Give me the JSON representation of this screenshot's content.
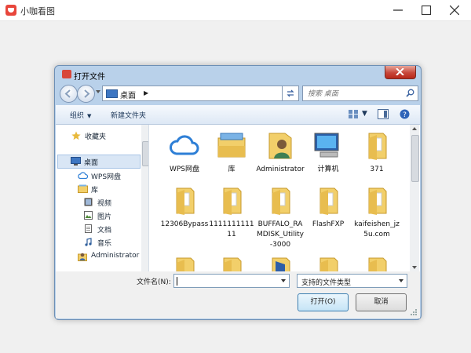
{
  "app": {
    "title": "小咖看图"
  },
  "dialog": {
    "title": "打开文件",
    "address": {
      "location": "桌面"
    },
    "search": {
      "placeholder": "搜索 桌面"
    },
    "toolbar": {
      "organize": "组织",
      "new_folder": "新建文件夹"
    },
    "sidebar": {
      "items": [
        {
          "label": "收藏夹",
          "icon": "star-icon"
        },
        {
          "label": "桌面",
          "icon": "desktop-icon",
          "selected": true
        },
        {
          "label": "WPS网盘",
          "icon": "cloud-icon"
        },
        {
          "label": "库",
          "icon": "library-icon"
        },
        {
          "label": "视频",
          "icon": "video-icon"
        },
        {
          "label": "图片",
          "icon": "picture-icon"
        },
        {
          "label": "文档",
          "icon": "document-icon"
        },
        {
          "label": "音乐",
          "icon": "music-icon"
        },
        {
          "label": "Administrator",
          "icon": "user-icon"
        }
      ]
    },
    "files": [
      {
        "name": "WPS网盘",
        "icon": "cloud-icon"
      },
      {
        "name": "库",
        "icon": "library-icon"
      },
      {
        "name": "Administrator",
        "icon": "user-folder-icon"
      },
      {
        "name": "计算机",
        "icon": "computer-icon"
      },
      {
        "name": "371",
        "icon": "folder-icon"
      },
      {
        "name": "12306Bypass",
        "icon": "folder-icon"
      },
      {
        "name": "111111111111",
        "icon": "folder-icon"
      },
      {
        "name": "BUFFALO_RAMDISK_Utility-3000",
        "icon": "folder-icon"
      },
      {
        "name": "FlashFXP",
        "icon": "folder-icon"
      },
      {
        "name": "kaifeishen_jz5u.com",
        "icon": "folder-icon"
      },
      {
        "name": "",
        "icon": "folder-icon"
      },
      {
        "name": "",
        "icon": "folder-icon"
      },
      {
        "name": "",
        "icon": "folder-icon"
      },
      {
        "name": "",
        "icon": "folder-icon"
      },
      {
        "name": "",
        "icon": "folder-icon"
      }
    ],
    "filename": {
      "label": "文件名(N):",
      "value": ""
    },
    "filetype": {
      "selected": "支持的文件类型"
    },
    "buttons": {
      "open": "打开(O)",
      "cancel": "取消"
    }
  },
  "colors": {
    "accent": "#3c7fb1",
    "close_red": "#c7473a",
    "folder": "#f2cf6a"
  }
}
